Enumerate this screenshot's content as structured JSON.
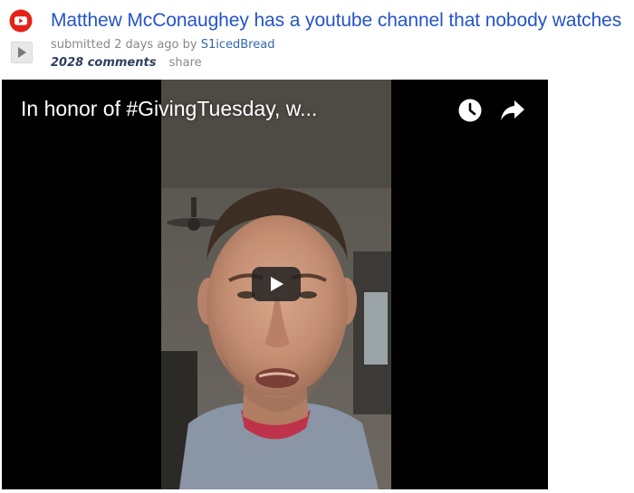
{
  "post": {
    "title": "Matthew McConaughey has a youtube channel that nobody watches",
    "tagline_prefix": "submitted 2 days ago by ",
    "author": "S1icedBread",
    "comments": "2028 comments",
    "share": "share"
  },
  "video": {
    "title": "In honor of #GivingTuesday, w..."
  },
  "icons": {
    "source": "youtube-icon",
    "expando": "play-expando-icon",
    "watch_later": "clock-icon",
    "share": "share-arrow-icon",
    "play": "play-icon"
  },
  "colors": {
    "title_link": "#2454c8",
    "author_link": "#3366aa",
    "comments": "#2f3f5f",
    "muted": "#888888",
    "youtube_red": "#e62117",
    "video_bg": "#000000"
  }
}
